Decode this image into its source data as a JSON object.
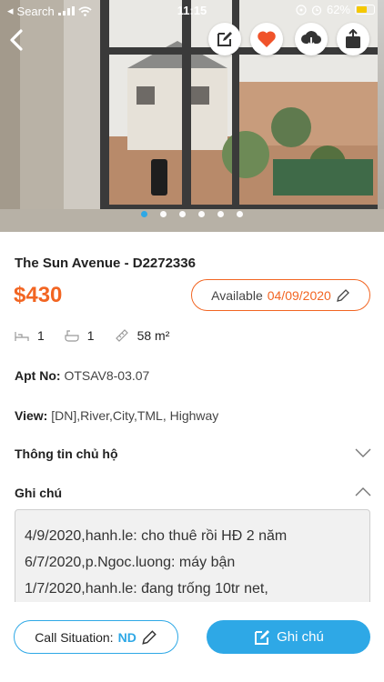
{
  "status_bar": {
    "back_app": "Search",
    "time": "11:15",
    "battery": "62%",
    "battery_level": 0.62
  },
  "hero": {
    "image_count": 6,
    "active_index": 0,
    "actions": [
      "edit-icon",
      "heart-icon",
      "cloud-download-icon",
      "share-icon"
    ]
  },
  "listing": {
    "title": "The Sun Avenue - D2272336",
    "price": "$430",
    "available_label": "Available",
    "available_date": "04/09/2020",
    "bedrooms": "1",
    "bathrooms": "1",
    "area": "58 m²",
    "apt_label": "Apt No:",
    "apt_value": "OTSAV8-03.07",
    "view_label": "View:",
    "view_value": "[DN],River,City,TML, Highway"
  },
  "sections": {
    "owner_info": "Thông tin chủ hộ",
    "notes": "Ghi chú"
  },
  "notes": [
    "4/9/2020,hanh.le: cho thuê rồi HĐ 2 năm",
    "6/7/2020,p.Ngoc.luong: máy bận",
    "1/7/2020,hanh.le: đang trống 10tr net,"
  ],
  "bottom": {
    "call_label": "Call Situation:",
    "call_value": "ND",
    "note_button": "Ghi chú"
  },
  "colors": {
    "accent_orange": "#f26522",
    "accent_blue": "#2ea8e6",
    "heart_red": "#f0532a"
  }
}
